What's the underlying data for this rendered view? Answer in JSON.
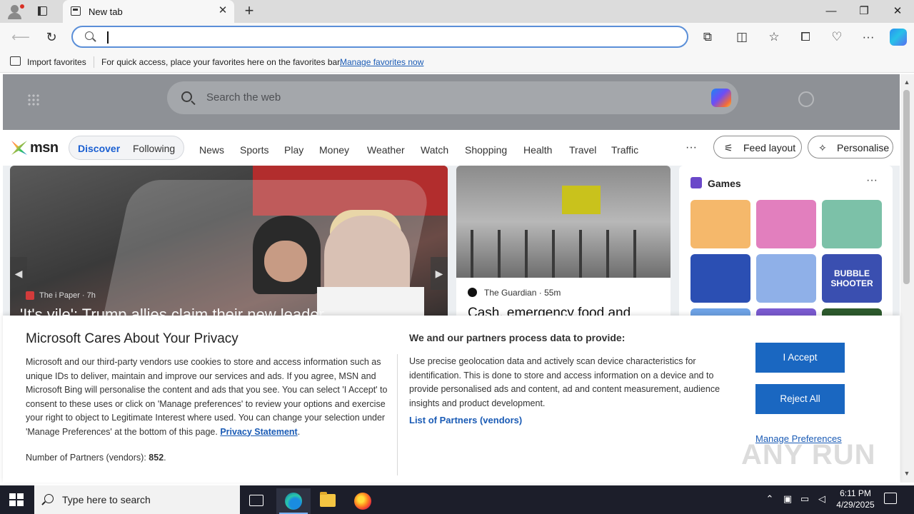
{
  "browser": {
    "tab_title": "New tab",
    "tab_close": "✕",
    "new_tab": "+",
    "window_controls": {
      "minimize": "—",
      "restore": "❐",
      "close": "✕"
    },
    "address_value": "",
    "toolbar_icons": [
      "extensions-icon",
      "split-screen-icon",
      "favorites-star-icon",
      "collections-icon",
      "browser-essentials-icon",
      "more-menu-icon",
      "copilot-icon"
    ]
  },
  "favorites_bar": {
    "import_label": "Import favorites",
    "hint": "For quick access, place your favorites here on the favorites bar.",
    "manage_link": "Manage favorites now"
  },
  "msn": {
    "search_placeholder": "Search the web",
    "logo_text": "msn",
    "feed_toggle": {
      "active": "Discover",
      "inactive": "Following"
    },
    "nav_items": [
      "News",
      "Sports",
      "Play",
      "Money",
      "Weather",
      "Watch",
      "Shopping",
      "Health",
      "Travel",
      "Traffic"
    ],
    "more": "···",
    "feed_layout_label": "Feed layout",
    "personalise_label": "Personalise",
    "main_card": {
      "source": "The i Paper",
      "age": "7h",
      "headline": "'It's vile': Trump allies claim their new leader"
    },
    "news_card": {
      "source": "The Guardian",
      "age": "55m",
      "headline": "Cash, emergency food and"
    },
    "games": {
      "title": "Games",
      "more": "···",
      "tiles": [
        {
          "label": "",
          "color": "#f5b86b"
        },
        {
          "label": "",
          "color": "#e27fbe"
        },
        {
          "label": "",
          "color": "#7cc1a8"
        },
        {
          "label": "",
          "color": "#2b4fb3"
        },
        {
          "label": "",
          "color": "#8fb0e8"
        },
        {
          "label": "BUBBLE SHOOTER",
          "color": "#3a4fb0"
        }
      ]
    }
  },
  "privacy": {
    "title": "Microsoft Cares About Your Privacy",
    "body": "Microsoft and our third-party vendors use cookies to store and access information such as unique IDs to deliver, maintain and improve our services and ads. If you agree, MSN and Microsoft Bing will personalise the content and ads that you see. You can select 'I Accept' to consent to these uses or click on 'Manage preferences' to review your options and exercise your right to object to Legitimate Interest where used. You can change your selection under 'Manage Preferences' at the bottom of this page.",
    "privacy_link": "Privacy Statement",
    "partners_count_label": "Number of Partners (vendors):",
    "partners_count": "852",
    "subtitle": "We and our partners process data to provide:",
    "body2": "Use precise geolocation data and actively scan device characteristics for identification. This is done to store and access information on a device and to provide personalised ads and content, ad and content measurement, audience insights and product development.",
    "partners_link": "List of Partners (vendors)",
    "accept": "I Accept",
    "reject": "Reject All",
    "manage": "Manage Preferences"
  },
  "watermark": "ANY RUN",
  "taskbar": {
    "search_placeholder": "Type here to search",
    "time": "6:11 PM",
    "date": "4/29/2025"
  }
}
